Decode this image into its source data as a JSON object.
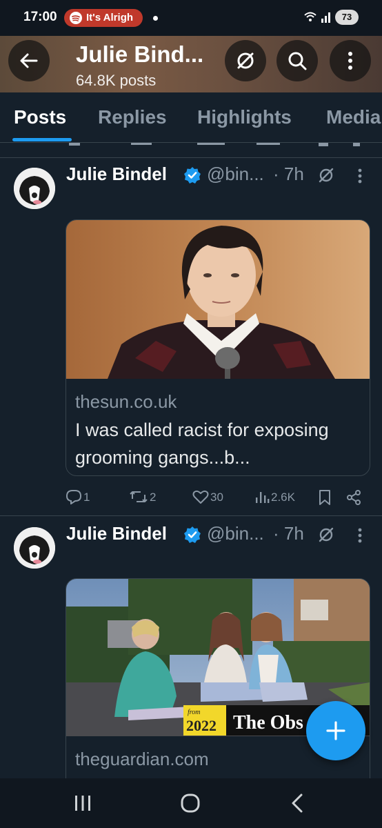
{
  "status_bar": {
    "time": "17:00",
    "spotify_text": "It's Alrigh",
    "battery": "73"
  },
  "header": {
    "title": "Julie Bind...",
    "subtitle": "64.8K posts"
  },
  "tabs": [
    {
      "label": "Posts",
      "active": true
    },
    {
      "label": "Replies",
      "active": false
    },
    {
      "label": "Highlights",
      "active": false
    },
    {
      "label": "Media",
      "active": false
    }
  ],
  "tweets": [
    {
      "author": "Julie Bindel",
      "handle": "@bin...",
      "time": "· 7h",
      "card": {
        "domain": "thesun.co.uk",
        "title": "I was called racist for exposing grooming gangs...b..."
      },
      "actions": {
        "replies": "1",
        "retweets": "2",
        "likes": "30",
        "views": "2.6K"
      }
    },
    {
      "author": "Julie Bindel",
      "handle": "@bin...",
      "time": "· 7h",
      "card": {
        "domain": "theguardian.com",
        "badge_from": "from",
        "badge_year": "2022",
        "badge_pub": "The Obs"
      }
    }
  ],
  "colors": {
    "background": "#15202b",
    "accent": "#1d9bf0",
    "secondary_text": "#8b98a5",
    "verified": "#1d9bf0"
  },
  "icons": [
    "back-arrow-icon",
    "grok-icon",
    "search-icon",
    "more-vertical-icon",
    "verified-badge-icon",
    "reply-icon",
    "retweet-icon",
    "like-icon",
    "views-icon",
    "bookmark-icon",
    "share-icon",
    "compose-plus-icon"
  ]
}
